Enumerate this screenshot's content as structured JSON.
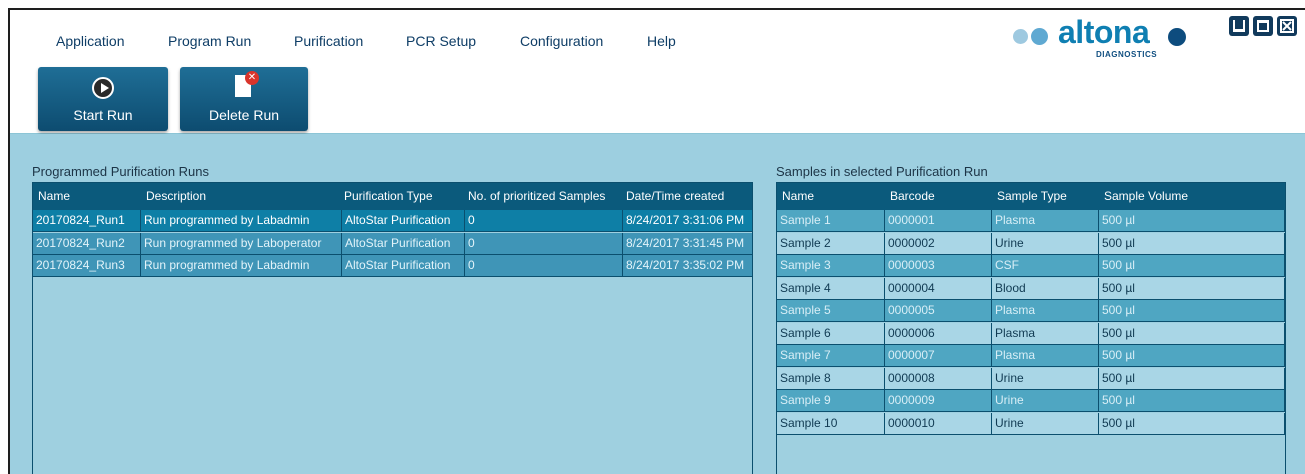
{
  "menu": [
    "Application",
    "Program Run",
    "Purification",
    "PCR Setup",
    "Configuration",
    "Help"
  ],
  "logo": {
    "word": "altona",
    "sub": "DIAGNOSTICS"
  },
  "toolbar": {
    "start_run": "Start Run",
    "delete_run": "Delete Run"
  },
  "runs": {
    "title": "Programmed Purification Runs",
    "columns": [
      "Name",
      "Description",
      "Purification Type",
      "No. of prioritized Samples",
      "Date/Time created"
    ],
    "rows": [
      [
        "20170824_Run1",
        "Run programmed by Labadmin",
        "AltoStar Purification",
        "0",
        "8/24/2017 3:31:06 PM"
      ],
      [
        "20170824_Run2",
        "Run programmed by Laboperator",
        "AltoStar Purification",
        "0",
        "8/24/2017 3:31:45 PM"
      ],
      [
        "20170824_Run3",
        "Run programmed by Labadmin",
        "AltoStar Purification",
        "0",
        "8/24/2017 3:35:02 PM"
      ]
    ]
  },
  "samples": {
    "title": "Samples in selected Purification Run",
    "columns": [
      "Name",
      "Barcode",
      "Sample Type",
      "Sample Volume"
    ],
    "rows": [
      [
        "Sample 1",
        "0000001",
        "Plasma",
        "500 µl"
      ],
      [
        "Sample 2",
        "0000002",
        "Urine",
        "500 µl"
      ],
      [
        "Sample 3",
        "0000003",
        "CSF",
        "500 µl"
      ],
      [
        "Sample 4",
        "0000004",
        "Blood",
        "500 µl"
      ],
      [
        "Sample 5",
        "0000005",
        "Plasma",
        "500 µl"
      ],
      [
        "Sample 6",
        "0000006",
        "Plasma",
        "500 µl"
      ],
      [
        "Sample 7",
        "0000007",
        "Plasma",
        "500 µl"
      ],
      [
        "Sample 8",
        "0000008",
        "Urine",
        "500 µl"
      ],
      [
        "Sample 9",
        "0000009",
        "Urine",
        "500 µl"
      ],
      [
        "Sample 10",
        "0000010",
        "Urine",
        "500 µl"
      ]
    ]
  },
  "colors": {
    "accent": "#0b5a7c",
    "selected_row": "#0e7fa6",
    "row_dark": "#4fa6c2",
    "row_light": "#9fd0e0",
    "logo_blue": "#0f7fb2"
  }
}
